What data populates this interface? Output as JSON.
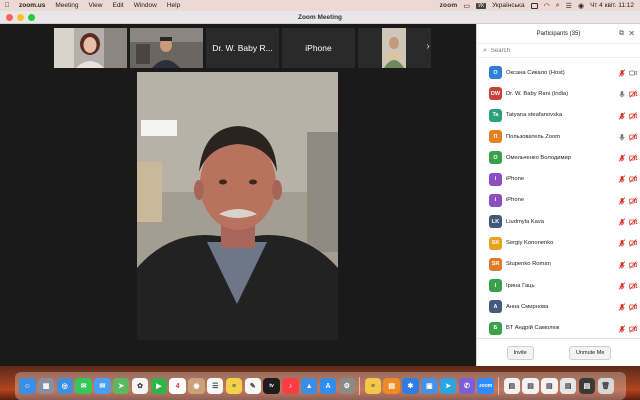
{
  "menubar": {
    "app": "zoom.us",
    "menus": [
      "Meeting",
      "View",
      "Edit",
      "Window",
      "Help"
    ],
    "status_zoom": "zoom",
    "keyboard_badge": "УК",
    "keyboard_lang": "Українська",
    "datetime": "Чт 4 квіт.  11:12"
  },
  "window": {
    "title": "Zoom Meeting"
  },
  "strip": {
    "tiles": [
      {
        "kind": "video",
        "label": ""
      },
      {
        "kind": "video",
        "label": ""
      },
      {
        "kind": "name",
        "label": "Dr. W. Baby R..."
      },
      {
        "kind": "name",
        "label": "iPhone"
      },
      {
        "kind": "video",
        "label": ""
      }
    ],
    "next_label": "›"
  },
  "panel": {
    "title": "Participants (35)",
    "search_placeholder": "Search",
    "invite_label": "Invite",
    "unmute_label": "Unmute Me",
    "participants": [
      {
        "initials": "O",
        "color": "#2e7fd6",
        "name": "Оксана Сикало (Host)",
        "mic": "muted",
        "video": "on"
      },
      {
        "initials": "DW",
        "color": "#c8413a",
        "name": "Dr. W. Baby Rani  (India)",
        "mic": "on",
        "video": "off"
      },
      {
        "initials": "Ta",
        "color": "#2aa37a",
        "name": "Tatyana steafanovska",
        "mic": "muted",
        "video": "off"
      },
      {
        "initials": "П",
        "color": "#e1821e",
        "name": "Пользователь Zoom",
        "mic": "on",
        "video": "off"
      },
      {
        "initials": "O",
        "color": "#3aa14a",
        "name": "Омельченко Володимир",
        "mic": "muted",
        "video": "off"
      },
      {
        "initials": "i",
        "color": "#8b4fc2",
        "name": "iPhone",
        "mic": "muted",
        "video": "off"
      },
      {
        "initials": "i",
        "color": "#8b4fc2",
        "name": "iPhone",
        "mic": "muted",
        "video": "off"
      },
      {
        "initials": "LK",
        "color": "#455a7a",
        "name": "Liudmyla Kava",
        "mic": "muted",
        "video": "off"
      },
      {
        "initials": "SK",
        "color": "#e8a21f",
        "name": "Sergiy Kononenko",
        "mic": "muted",
        "video": "off"
      },
      {
        "initials": "SR",
        "color": "#e07b2a",
        "name": "Stupenko Roman",
        "mic": "muted",
        "video": "off"
      },
      {
        "initials": "I",
        "color": "#3aa14a",
        "name": "Ірина Гаць",
        "mic": "muted",
        "video": "off"
      },
      {
        "initials": "A",
        "color": "#455a7a",
        "name": "Анна Смирнова",
        "mic": "muted",
        "video": "off"
      },
      {
        "initials": "Б",
        "color": "#3aa14a",
        "name": "БТ Андрій Самолюк",
        "mic": "muted",
        "video": "off"
      }
    ]
  },
  "dock": {
    "calendar_day": "4",
    "items": [
      {
        "name": "finder",
        "color": "#3a8ee6",
        "glyph": "☺"
      },
      {
        "name": "launchpad",
        "color": "#8a8fa0",
        "glyph": "▦"
      },
      {
        "name": "safari",
        "color": "#3d8fe0",
        "glyph": "◎"
      },
      {
        "name": "messages",
        "color": "#35c759",
        "glyph": "✉"
      },
      {
        "name": "mail",
        "color": "#4a9ff0",
        "glyph": "✉"
      },
      {
        "name": "maps",
        "color": "#5cb85c",
        "glyph": "➤"
      },
      {
        "name": "photos",
        "color": "#f4f4f4",
        "glyph": "✿"
      },
      {
        "name": "facetime",
        "color": "#2fb34a",
        "glyph": "▶"
      },
      {
        "name": "calendar",
        "color": "#ffffff",
        "glyph": "4"
      },
      {
        "name": "contacts",
        "color": "#c8a27a",
        "glyph": "◉"
      },
      {
        "name": "reminders",
        "color": "#f7f7f7",
        "glyph": "☰"
      },
      {
        "name": "notes",
        "color": "#f5d04a",
        "glyph": "≡"
      },
      {
        "name": "freeform",
        "color": "#f7f7f7",
        "glyph": "✎"
      },
      {
        "name": "tv",
        "color": "#1d1d1f",
        "glyph": "tv"
      },
      {
        "name": "music",
        "color": "#fc3c44",
        "glyph": "♪"
      },
      {
        "name": "keynote",
        "color": "#3a8ee6",
        "glyph": "▲"
      },
      {
        "name": "app-store",
        "color": "#2f8cf0",
        "glyph": "A"
      },
      {
        "name": "system-settings",
        "color": "#8a8a8a",
        "glyph": "⚙"
      },
      {
        "name": "sep",
        "color": "",
        "glyph": ""
      },
      {
        "name": "notes-yellow",
        "color": "#f2c84b",
        "glyph": "≡"
      },
      {
        "name": "books",
        "color": "#f08a24",
        "glyph": "▤"
      },
      {
        "name": "bluetooth",
        "color": "#2f7de1",
        "glyph": "✱"
      },
      {
        "name": "files",
        "color": "#4a90e2",
        "glyph": "▣"
      },
      {
        "name": "telegram",
        "color": "#2aa5e0",
        "glyph": "➤"
      },
      {
        "name": "viber",
        "color": "#7b5fd6",
        "glyph": "✆"
      },
      {
        "name": "zoom",
        "color": "#2d8cff",
        "glyph": "zoom"
      },
      {
        "name": "sep",
        "color": "",
        "glyph": ""
      },
      {
        "name": "doc-1",
        "color": "#f2f2f2",
        "glyph": "▤"
      },
      {
        "name": "doc-2",
        "color": "#f2f2f2",
        "glyph": "▤"
      },
      {
        "name": "doc-3",
        "color": "#f2f2f2",
        "glyph": "▤"
      },
      {
        "name": "doc-4",
        "color": "#e6e6e6",
        "glyph": "▤"
      },
      {
        "name": "doc-5",
        "color": "#3a3a3a",
        "glyph": "▤"
      },
      {
        "name": "trash",
        "color": "#d8d8d8",
        "glyph": "🗑"
      }
    ]
  }
}
